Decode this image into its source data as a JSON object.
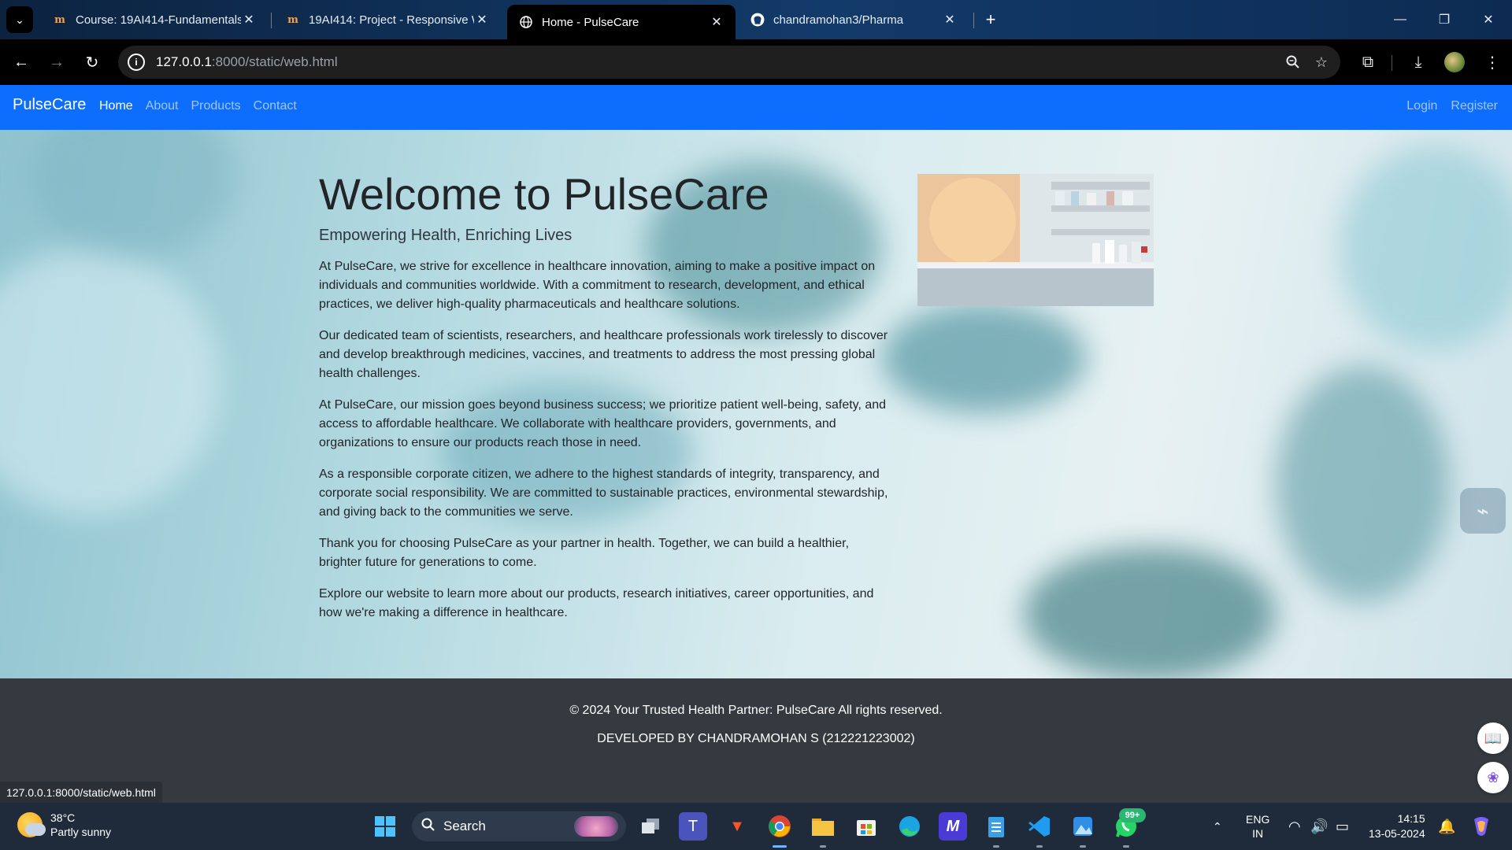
{
  "browser": {
    "tabs": [
      {
        "title": "Course: 19AI414-Fundamentals",
        "favicon": "moodle-icon",
        "active": false
      },
      {
        "title": "19AI414: Project - Responsive W",
        "favicon": "moodle-icon",
        "active": false
      },
      {
        "title": "Home - PulseCare",
        "favicon": "globe-icon",
        "active": true
      },
      {
        "title": "chandramohan3/Pharma",
        "favicon": "github-icon",
        "active": false
      }
    ],
    "new_tab_label": "+",
    "address": {
      "host": "127.0.0.1",
      "path": ":8000/static/web.html"
    },
    "status_url": "127.0.0.1:8000/static/web.html"
  },
  "site": {
    "brand": "PulseCare",
    "nav": [
      "Home",
      "About",
      "Products",
      "Contact"
    ],
    "active_nav": "Home",
    "auth": [
      "Login",
      "Register"
    ],
    "accent_color": "#0d6efd",
    "footer_color": "#343a40"
  },
  "hero": {
    "title": "Welcome to PulseCare",
    "lead": "Empowering Health, Enriching Lives",
    "paragraphs": [
      "At PulseCare, we strive for excellence in healthcare innovation, aiming to make a positive impact on individuals and communities worldwide. With a commitment to research, development, and ethical practices, we deliver high-quality pharmaceuticals and healthcare solutions.",
      "Our dedicated team of scientists, researchers, and healthcare professionals work tirelessly to discover and develop breakthrough medicines, vaccines, and treatments to address the most pressing global health challenges.",
      "At PulseCare, our mission goes beyond business success; we prioritize patient well-being, safety, and access to affordable healthcare. We collaborate with healthcare providers, governments, and organizations to ensure our products reach those in need.",
      "As a responsible corporate citizen, we adhere to the highest standards of integrity, transparency, and corporate social responsibility. We are committed to sustainable practices, environmental stewardship, and giving back to the communities we serve.",
      "Thank you for choosing PulseCare as your partner in health. Together, we can build a healthier, brighter future for generations to come.",
      "Explore our website to learn more about our products, research initiatives, career opportunities, and how we're making a difference in healthcare."
    ]
  },
  "footer": {
    "copyright": "© 2024 Your Trusted Health Partner: PulseCare All rights reserved.",
    "developer": "DEVELOPED BY CHANDRAMOHAN S (212221223002)"
  },
  "taskbar": {
    "weather_temp": "38°C",
    "weather_desc": "Partly sunny",
    "search_label": "Search",
    "whatsapp_badge": "99+",
    "language_line1": "ENG",
    "language_line2": "IN",
    "time": "14:15",
    "date": "13-05-2024"
  }
}
